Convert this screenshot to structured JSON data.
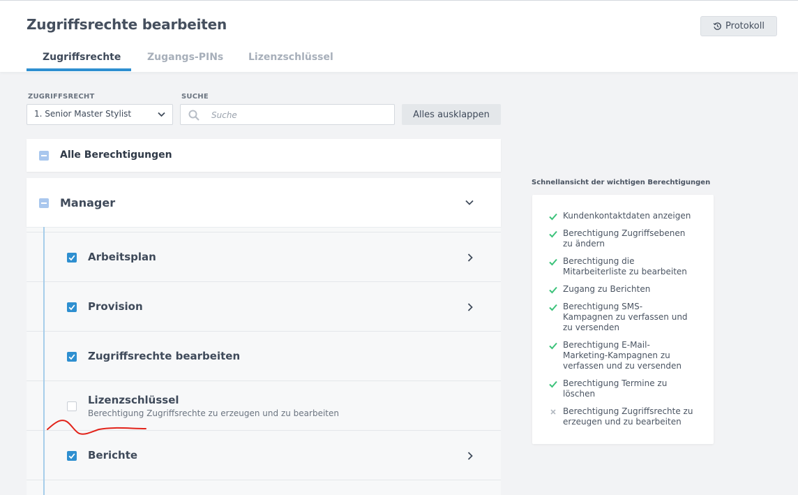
{
  "header": {
    "title": "Zugriffsrechte bearbeiten",
    "protokoll_label": "Protokoll",
    "tabs": [
      {
        "label": "Zugriffsrechte",
        "active": true
      },
      {
        "label": "Zugangs-PINs",
        "active": false
      },
      {
        "label": "Lizenzschlüssel",
        "active": false
      }
    ]
  },
  "filters": {
    "access_label": "ZUGRIFFSRECHT",
    "access_value": "1. Senior Master Stylist",
    "search_label": "SUCHE",
    "search_placeholder": "Suche",
    "expand_all_label": "Alles ausklappen"
  },
  "permissions": {
    "all_label": "Alle Berechtigungen",
    "group_label": "Manager",
    "items": [
      {
        "label": "Arbeitsplan",
        "checked": true,
        "expandable": true
      },
      {
        "label": "Provision",
        "checked": true,
        "expandable": true
      },
      {
        "label": "Zugriffsrechte bearbeiten",
        "checked": true,
        "expandable": false
      },
      {
        "label": "Lizenzschlüssel",
        "sublabel": "Berechtigung Zugriffsrechte zu erzeugen und zu bearbeiten",
        "checked": false,
        "expandable": false
      },
      {
        "label": "Berichte",
        "checked": true,
        "expandable": true
      }
    ]
  },
  "quickview": {
    "title": "Schnellansicht der wichtigen Berechtigungen",
    "items": [
      {
        "lines": [
          "Kundenkontaktdaten anzeigen"
        ],
        "granted": true
      },
      {
        "lines": [
          "Berechtigung Zugriffsebenen",
          "zu ändern"
        ],
        "granted": true
      },
      {
        "lines": [
          "Berechtigung die",
          "Mitarbeiterliste zu bearbeiten"
        ],
        "granted": true
      },
      {
        "lines": [
          "Zugang zu Berichten"
        ],
        "granted": true
      },
      {
        "lines": [
          "Berechtigung SMS-",
          "Kampagnen zu verfassen und",
          "zu versenden"
        ],
        "granted": true
      },
      {
        "lines": [
          "Berechtigung E-Mail-",
          "Marketing-Kampagnen zu",
          "verfassen und zu versenden"
        ],
        "granted": true
      },
      {
        "lines": [
          "Berechtigung Termine zu",
          "löschen"
        ],
        "granted": true
      },
      {
        "lines": [
          "Berechtigung Zugriffsrechte zu",
          "erzeugen und zu bearbeiten"
        ],
        "granted": false
      }
    ]
  },
  "colors": {
    "accent": "#2e8fd0",
    "check_green": "#3cc27a",
    "deny_grey": "#b3b9c1",
    "annotation_red": "#e2231a"
  }
}
